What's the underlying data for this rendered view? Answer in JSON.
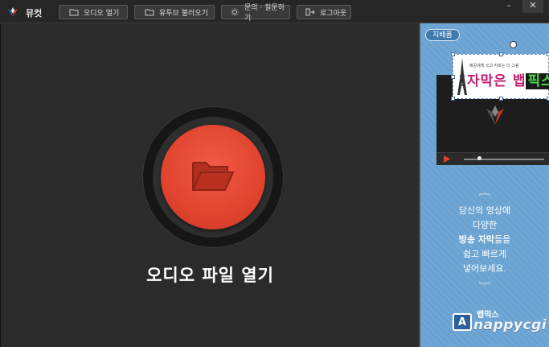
{
  "app": {
    "title": "뮤컷"
  },
  "toolbar": {
    "open_audio": "오디오 열기",
    "youtube": "유투브 불러오기",
    "inquiry": "문의 · 질문하기",
    "logout": "로그아웃"
  },
  "window_controls": {
    "minimize": "–",
    "close": "✕"
  },
  "main": {
    "open_label": "오디오 파일 열기"
  },
  "side": {
    "pill": "지배폼",
    "sticker_small": "배공에게 쓰고 자르는 더 그림",
    "sticker_text": "자막은 뱁",
    "sticker_text_dark": "픽스",
    "promo": {
      "line1": "당신의 영상에",
      "line2": "다양한",
      "line3_bold": "방송 자막",
      "line3_rest": "들을",
      "line4": "쉽고 빠르게",
      "line5": "넣어보세요."
    },
    "brand_ko": "뱁믹스",
    "brand_badge": "A",
    "brand_en": "nappycgi"
  },
  "colors": {
    "accent": "#e1442f",
    "side_bg": "#6aa3d2",
    "dark_bg": "#2b2b2b"
  }
}
